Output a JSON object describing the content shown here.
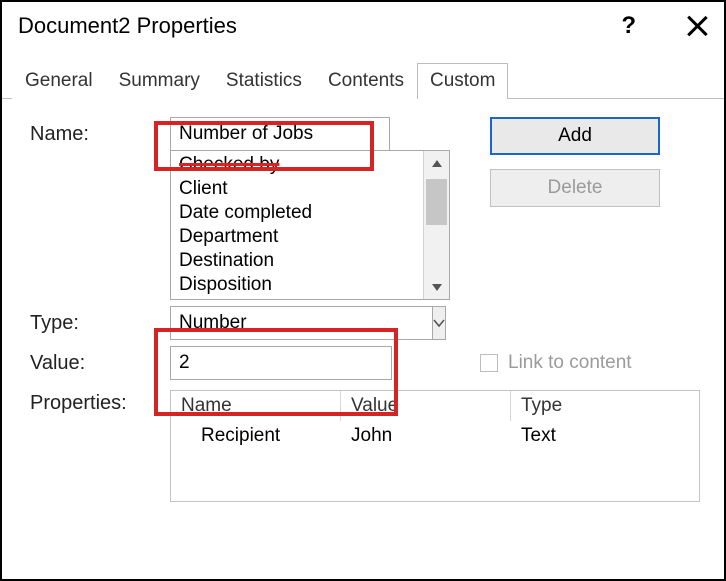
{
  "window": {
    "title": "Document2 Properties"
  },
  "tabs": {
    "general": "General",
    "summary": "Summary",
    "statistics": "Statistics",
    "contents": "Contents",
    "custom": "Custom"
  },
  "labels": {
    "name": "Name:",
    "type": "Type:",
    "value": "Value:",
    "properties": "Properties:"
  },
  "name_field": {
    "value": "Number of Jobs"
  },
  "name_suggestions": [
    "Checked by",
    "Client",
    "Date completed",
    "Department",
    "Destination",
    "Disposition"
  ],
  "type_field": {
    "value": "Number"
  },
  "value_field": {
    "value": "2"
  },
  "buttons": {
    "add": "Add",
    "delete": "Delete"
  },
  "link_checkbox": {
    "label": "Link to content",
    "checked": false,
    "enabled": false
  },
  "props_table": {
    "headers": {
      "name": "Name",
      "value": "Value",
      "type": "Type"
    },
    "rows": [
      {
        "name": "Recipient",
        "value": "John",
        "type": "Text"
      }
    ]
  }
}
